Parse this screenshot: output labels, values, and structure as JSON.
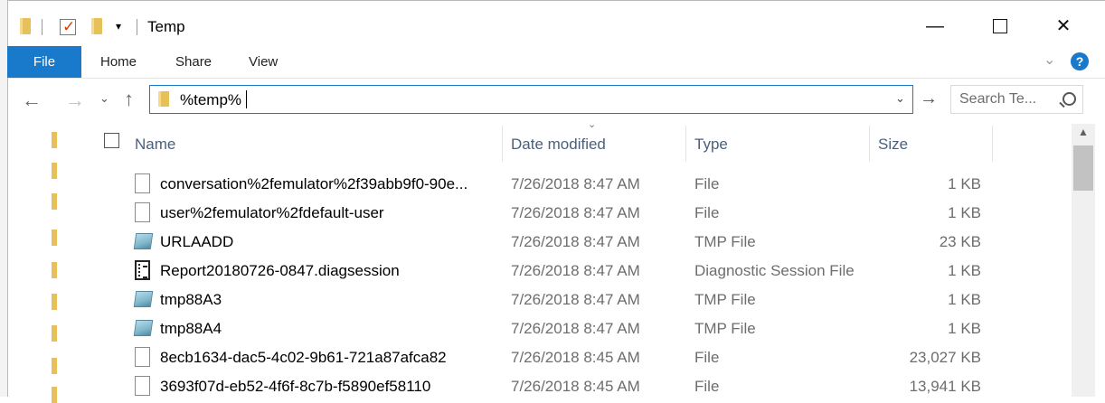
{
  "window": {
    "title": "Temp",
    "controls": {
      "minimize": "—",
      "maximize": "",
      "close": "✕"
    }
  },
  "quick_access": {
    "dropdown": "▾"
  },
  "ribbon": {
    "file_tab": "File",
    "tabs": [
      "Home",
      "Share",
      "View"
    ],
    "expand_icon": "⌄",
    "help": "?"
  },
  "nav": {
    "back": "←",
    "forward": "→",
    "recent": "⌄",
    "up": "↑"
  },
  "address": {
    "value": "%temp%",
    "dropdown": "⌄",
    "go": "→"
  },
  "search": {
    "placeholder": "Search Te..."
  },
  "columns": {
    "name": "Name",
    "date": "Date modified",
    "type": "Type",
    "size": "Size",
    "sort_indicator": "⌄"
  },
  "files": [
    {
      "name": "conversation%2femulator%2f39abb9f0-90e...",
      "date": "7/26/2018 8:47 AM",
      "type": "File",
      "size": "1 KB",
      "icon": "plain"
    },
    {
      "name": "user%2femulator%2fdefault-user",
      "date": "7/26/2018 8:47 AM",
      "type": "File",
      "size": "1 KB",
      "icon": "plain"
    },
    {
      "name": "URLAADD",
      "date": "7/26/2018 8:47 AM",
      "type": "TMP File",
      "size": "23 KB",
      "icon": "tmp"
    },
    {
      "name": "Report20180726-0847.diagsession",
      "date": "7/26/2018 8:47 AM",
      "type": "Diagnostic Session File",
      "size": "1 KB",
      "icon": "diag"
    },
    {
      "name": "tmp88A3",
      "date": "7/26/2018 8:47 AM",
      "type": "TMP File",
      "size": "1 KB",
      "icon": "tmp"
    },
    {
      "name": "tmp88A4",
      "date": "7/26/2018 8:47 AM",
      "type": "TMP File",
      "size": "1 KB",
      "icon": "tmp"
    },
    {
      "name": "8ecb1634-dac5-4c02-9b61-721a87afca82",
      "date": "7/26/2018 8:45 AM",
      "type": "File",
      "size": "23,027 KB",
      "icon": "plain"
    },
    {
      "name": "3693f07d-eb52-4f6f-8c7b-f5890ef58110",
      "date": "7/26/2018 8:45 AM",
      "type": "File",
      "size": "13,941 KB",
      "icon": "plain"
    }
  ],
  "scrollbar": {
    "up_arrow": "▲"
  },
  "colors": {
    "accent": "#1979ca",
    "folder": "#e8c05a"
  }
}
